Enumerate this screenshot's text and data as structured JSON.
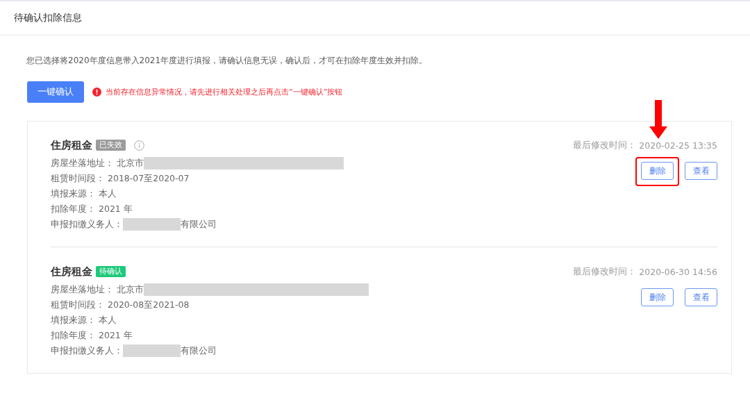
{
  "header": {
    "title": "待确认扣除信息"
  },
  "notice": "您已选择将2020年度信息带入2021年度进行填报，请确认信息无误，确认后，才可在扣除年度生效并扣除。",
  "confirm_button": "一键确认",
  "warning": "当前存在信息异常情况，请先进行相关处理之后再点击“一键确认”按钮",
  "records": [
    {
      "title": "住房租金",
      "status": "已失效",
      "color": "#9b9b9b",
      "info_icon": true,
      "modified_label": "最后修改时间：",
      "modified_time": "2020-02-25 13:35",
      "buttons": [
        {
          "label": "删除",
          "highlighted": true
        },
        {
          "label": "查看",
          "highlighted": false
        }
      ],
      "fields": [
        {
          "label": "房屋坐落地址：",
          "value": "北京市",
          "redacted_after": true
        },
        {
          "label": "租赁时间段：",
          "value": "2018-07至2020-07"
        },
        {
          "label": "填报来源：",
          "value": "本人"
        },
        {
          "label": "扣除年度：",
          "value": "2021 年"
        },
        {
          "label": "申报扣缴义务人：",
          "value": "有限公司",
          "redacted_before": true
        }
      ]
    },
    {
      "title": "住房租金",
      "status": "待确认",
      "color": "#1dc97a",
      "modified_label": "最后修改时间：",
      "modified_time": "2020-06-30 14:56",
      "buttons": [
        {
          "label": "删除",
          "highlighted": false
        },
        {
          "label": "查看",
          "highlighted": false
        }
      ],
      "fields": [
        {
          "label": "房屋坐落地址：",
          "value": "北京市",
          "redacted_after": true
        },
        {
          "label": "租赁时间段：",
          "value": "2020-08至2021-08"
        },
        {
          "label": "填报来源：",
          "value": "本人"
        },
        {
          "label": "扣除年度：",
          "value": "2021 年"
        },
        {
          "label": "申报扣缴义务人：",
          "value": "有限公司",
          "redacted_before": true
        }
      ]
    }
  ]
}
